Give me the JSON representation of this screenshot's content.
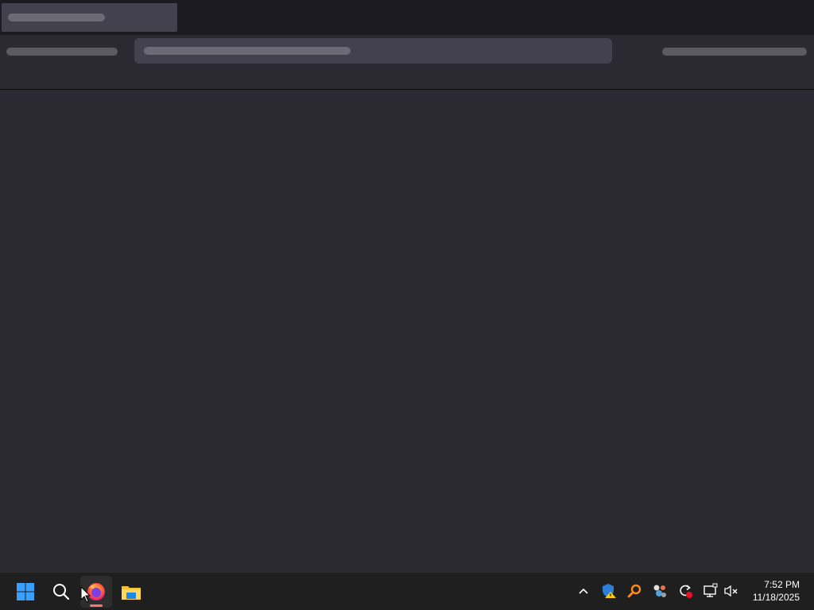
{
  "taskbar": {
    "pinned": [
      {
        "name": "start-button",
        "icon": "windows-logo-icon"
      },
      {
        "name": "search-button",
        "icon": "search-icon"
      },
      {
        "name": "firefox-button",
        "icon": "firefox-icon",
        "active": true
      },
      {
        "name": "file-explorer-button",
        "icon": "folder-icon"
      }
    ],
    "tray": [
      {
        "name": "show-hidden-icons-button",
        "icon": "chevron-up-icon"
      },
      {
        "name": "security-warning-icon",
        "icon": "shield-warning-icon"
      },
      {
        "name": "search-tool-icon",
        "icon": "magnifier-orange-icon"
      },
      {
        "name": "app-tray-icon",
        "icon": "network-app-icon"
      },
      {
        "name": "sync-icon",
        "icon": "sync-error-icon"
      },
      {
        "name": "network-icon",
        "icon": "monitor-network-icon"
      },
      {
        "name": "volume-icon",
        "icon": "speaker-muted-icon"
      }
    ],
    "clock": {
      "time": "7:52 PM",
      "date": "11/18/2025"
    }
  },
  "colors": {
    "page_bg": "#2b2a33",
    "tabbar_bg": "#1c1b22",
    "taskbar_bg": "#1f1f1f",
    "accent_indicator": "#f7766d"
  }
}
